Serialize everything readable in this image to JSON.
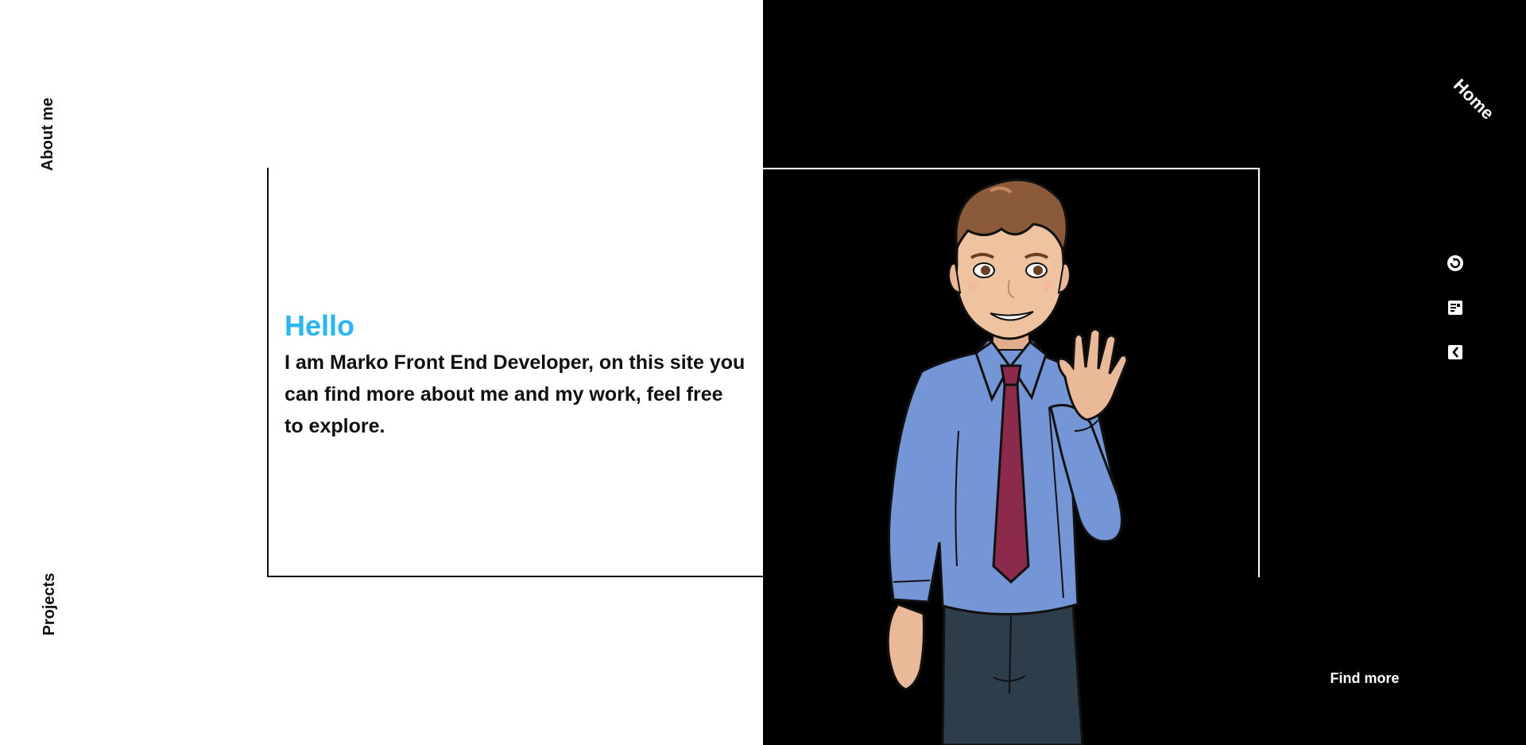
{
  "nav": {
    "about": "About me",
    "projects": "Projects",
    "home": "Home"
  },
  "intro": {
    "greeting": "Hello",
    "text": "I am Marko Front End Developer, on this site you can find more about me and my work, feel free to explore."
  },
  "cta": {
    "find_more": "Find more"
  },
  "social": [
    {
      "icon": "refresh-circle-icon"
    },
    {
      "icon": "blog-icon"
    },
    {
      "icon": "codepen-icon"
    }
  ],
  "colors": {
    "accent": "#29b6f6",
    "dark_bg": "#000000",
    "light_bg": "#ffffff",
    "shirt": "#7596d6",
    "tie": "#8b2a4a"
  }
}
